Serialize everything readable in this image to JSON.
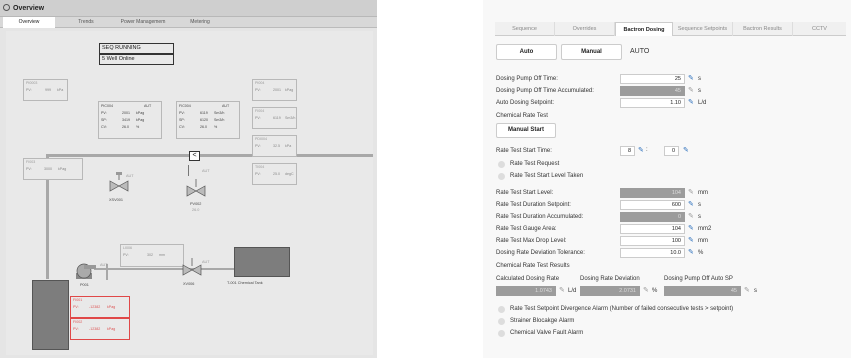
{
  "left_panel": {
    "title": "Overview",
    "tabs": [
      "Overview",
      "Trends",
      "Power Managemem",
      "Metering"
    ],
    "status_lines": [
      "SEQ RUNNING",
      "5 Well Online"
    ],
    "pi_left": {
      "tag": "PI0003",
      "pv_label": "PV:",
      "pv_value": "999",
      "pv_unit": "kPa"
    },
    "pic004": {
      "tag": "PIC004",
      "mode": "AUT",
      "rows": [
        {
          "label": "PV:",
          "value": "2001",
          "unit": "kPag"
        },
        {
          "label": "SP:",
          "value": "3419",
          "unit": "kPag"
        },
        {
          "label": "CV:",
          "value": "26.0",
          "unit": "%"
        }
      ]
    },
    "fic004": {
      "tag": "FIC004",
      "mode": "AUT",
      "rows": [
        {
          "label": "PV:",
          "value": "6119",
          "unit": "Sm3/h"
        },
        {
          "label": "SP:",
          "value": "6120",
          "unit": "Sm3/h"
        },
        {
          "label": "CV:",
          "value": "26.0",
          "unit": "%"
        }
      ]
    },
    "pi004": {
      "tag": "PI004",
      "pv_label": "PV:",
      "pv_value": "2001",
      "pv_unit": "kPag"
    },
    "fi004": {
      "tag": "FI004",
      "pv_label": "PV:",
      "pv_value": "6119",
      "pv_unit": "Sm3/h"
    },
    "pdi004": {
      "tag": "PDI004",
      "pv_label": "PV:",
      "pv_value": "32.5",
      "pv_unit": "kPa"
    },
    "ti004": {
      "tag": "TI004",
      "pv_label": "PV:",
      "pv_value": "25.0",
      "pv_unit": "degC"
    },
    "fi003": {
      "tag": "FI003",
      "pv_label": "PV:",
      "pv_value": "3000",
      "pv_unit": "kPag"
    },
    "valve1": {
      "name": "XSV001",
      "mode": "AUT"
    },
    "valve2": {
      "name": "PV002",
      "value": "26.0",
      "mode": "AUT"
    },
    "li": {
      "tag": "LI006",
      "pv_label": "PV:",
      "pv_value": "302",
      "pv_unit": "mm"
    },
    "pump": {
      "name": "P001",
      "mode": "AUT"
    },
    "valve3": {
      "name": "XV006",
      "mode": "AUT"
    },
    "tank": {
      "name": "T-001 Chemical Tank"
    },
    "red1": {
      "tag": "FI001",
      "pv_label": "PV:",
      "pv_value": "-12382",
      "pv_unit": "kPag"
    },
    "red2": {
      "tag": "FI002",
      "pv_label": "PV:",
      "pv_value": "-12382",
      "pv_unit": "kPag"
    }
  },
  "right_panel": {
    "tabs": [
      "Sequence",
      "Overrides",
      "Bactron Dosing",
      "Sequence Setpoints",
      "Bactron Results",
      "CCTV"
    ],
    "mode_auto": "Auto",
    "mode_manual": "Manual",
    "mode_status": "AUTO",
    "rows": [
      {
        "label": "Dosing Pump Off Time:",
        "value": "25",
        "unit": "s",
        "gray": false
      },
      {
        "label": "Dosing Pump Off Time Accumulated:",
        "value": "45",
        "unit": "s",
        "gray": true
      },
      {
        "label": "Auto Dosing Setpoint:",
        "value": "1.10",
        "unit": "L/d",
        "gray": false
      }
    ],
    "chem_rate_test": "Chemical Rate Test",
    "manual_start": "Manual Start",
    "start_time_label": "Rate Test Start Time:",
    "start_time_h": "8",
    "start_time_sep": ":",
    "start_time_m": "0",
    "check1": "Rate Test Request",
    "check2": "Rate Test Start Level Taken",
    "rows2": [
      {
        "label": "Rate Test Start Level:",
        "value": "104",
        "unit": "mm",
        "gray": true
      },
      {
        "label": "Rate Test Duration Setpoint:",
        "value": "600",
        "unit": "s",
        "gray": false
      },
      {
        "label": "Rate Test Duration Accumulated:",
        "value": "0",
        "unit": "s",
        "gray": true
      },
      {
        "label": "Rate Test Gauge Area:",
        "value": "104",
        "unit": "mm2",
        "gray": false
      },
      {
        "label": "Rate Test Max Drop Level:",
        "value": "100",
        "unit": "mm",
        "gray": false
      },
      {
        "label": "Dosing Rate Deviation Tolerance:",
        "value": "10.0",
        "unit": "%",
        "gray": false
      }
    ],
    "results_title": "Chemical Rate Test Results",
    "res_headers": [
      "Calculated Dosing Rate",
      "Dosing Rate Deviation",
      "Dosing Pump Off Auto SP"
    ],
    "res_values": [
      {
        "value": "1.0743",
        "unit": "L/d"
      },
      {
        "value": "2.0731",
        "unit": "%"
      },
      {
        "value": "45",
        "unit": "s"
      }
    ],
    "alarms": [
      "Rate Test Setpoint Divergence Alarm (Number of failed consecutive tests > setpoint)",
      "Strainer Blocakge Alarm",
      "Chemical Valve Fault Alarm"
    ]
  }
}
